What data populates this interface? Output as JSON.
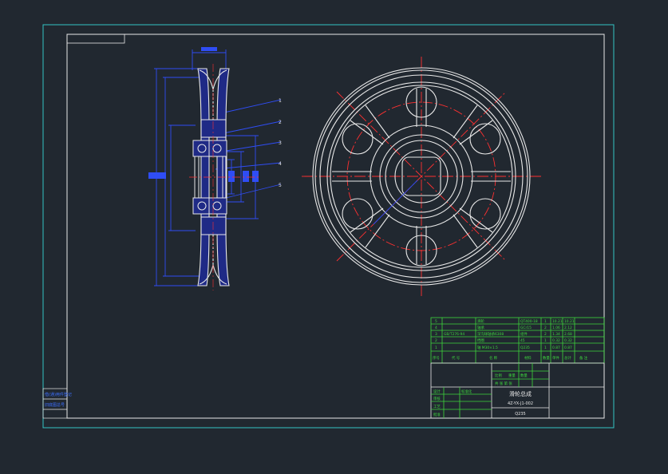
{
  "drawing": {
    "part_name": "滑轮总成",
    "drawing_no": "4Z-YX-J1-002",
    "sheet_note": "共 张 第 张",
    "material": "Q235",
    "label_ratio": "比例",
    "label_weight": "重量",
    "label_qty": "数量"
  },
  "bom": {
    "headers": [
      "序号",
      "代 号",
      "名 称",
      "材料",
      "数量",
      "单件",
      "总计",
      "备 注"
    ],
    "rows": [
      {
        "no": "5",
        "code": "",
        "name": "滑轮",
        "material": "QT400-18",
        "qty": "1",
        "unit": "10.21",
        "total": "10.21"
      },
      {
        "no": "4",
        "code": "",
        "name": "轴承",
        "material": "GCr15",
        "qty": "2",
        "unit": "1.06",
        "total": "2.12"
      },
      {
        "no": "3",
        "code": "GB/T276-94",
        "name": "深沟球轴承6308",
        "material": "组件",
        "qty": "2",
        "unit": "1.34",
        "total": "2.68"
      },
      {
        "no": "2",
        "code": "",
        "name": "挡圈",
        "material": "45",
        "qty": "1",
        "unit": "0.32",
        "total": "0.32"
      },
      {
        "no": "1",
        "code": "",
        "name": "轴 M30×1.5",
        "material": "Q235",
        "qty": "1",
        "unit": "0.87",
        "total": "0.87"
      }
    ]
  },
  "signoff": {
    "labels": [
      "设计",
      "审核",
      "工艺",
      "批准"
    ],
    "stamp": "标准化"
  },
  "side_stamps": [
    "借(通)用件登记",
    "旧底图总号"
  ],
  "balloons": [
    "1",
    "2",
    "3",
    "4",
    "5"
  ]
}
